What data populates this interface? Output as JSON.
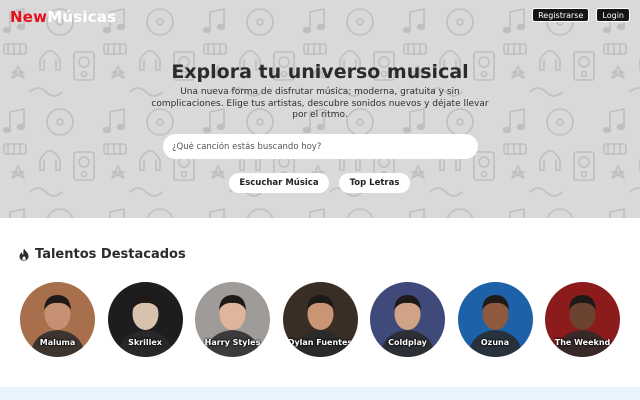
{
  "header": {
    "logo_part1": "New",
    "logo_part2": "Músicas",
    "register_label": "Registrarse",
    "login_label": "Login"
  },
  "hero": {
    "title": "Explora tu universo musical",
    "subtitle": "Una nueva forma de disfrutar música: moderna, gratuita y sin complicaciones. Elige tus artistas, descubre sonidos nuevos y déjate llevar por el ritmo.",
    "search_placeholder": "¿Qué canción estás buscando hoy?",
    "buttons": [
      {
        "label": "Escuchar Música"
      },
      {
        "label": "Top Letras"
      }
    ]
  },
  "featured": {
    "title": "Talentos Destacados",
    "title_icon": "flame-icon",
    "artists": [
      {
        "name": "Maluma",
        "bg": "#a76f4c",
        "skin": "#c69073"
      },
      {
        "name": "Skrillex",
        "bg": "#1d1d1f",
        "skin": "#d8c2ad"
      },
      {
        "name": "Harry Styles",
        "bg": "#9f9b98",
        "skin": "#e1b59c"
      },
      {
        "name": "Dylan Fuentes",
        "bg": "#3a2d26",
        "skin": "#c99575"
      },
      {
        "name": "Coldplay",
        "bg": "#3f4a7a",
        "skin": "#d1a386"
      },
      {
        "name": "Ozuna",
        "bg": "#1d61a8",
        "skin": "#8d5a40"
      },
      {
        "name": "The Weeknd",
        "bg": "#8c1c1c",
        "skin": "#6b4330"
      }
    ]
  },
  "colors": {
    "accent": "#e3101b",
    "hero_bg": "#d9d9d9",
    "bottom_band": "#e9f3fb"
  }
}
